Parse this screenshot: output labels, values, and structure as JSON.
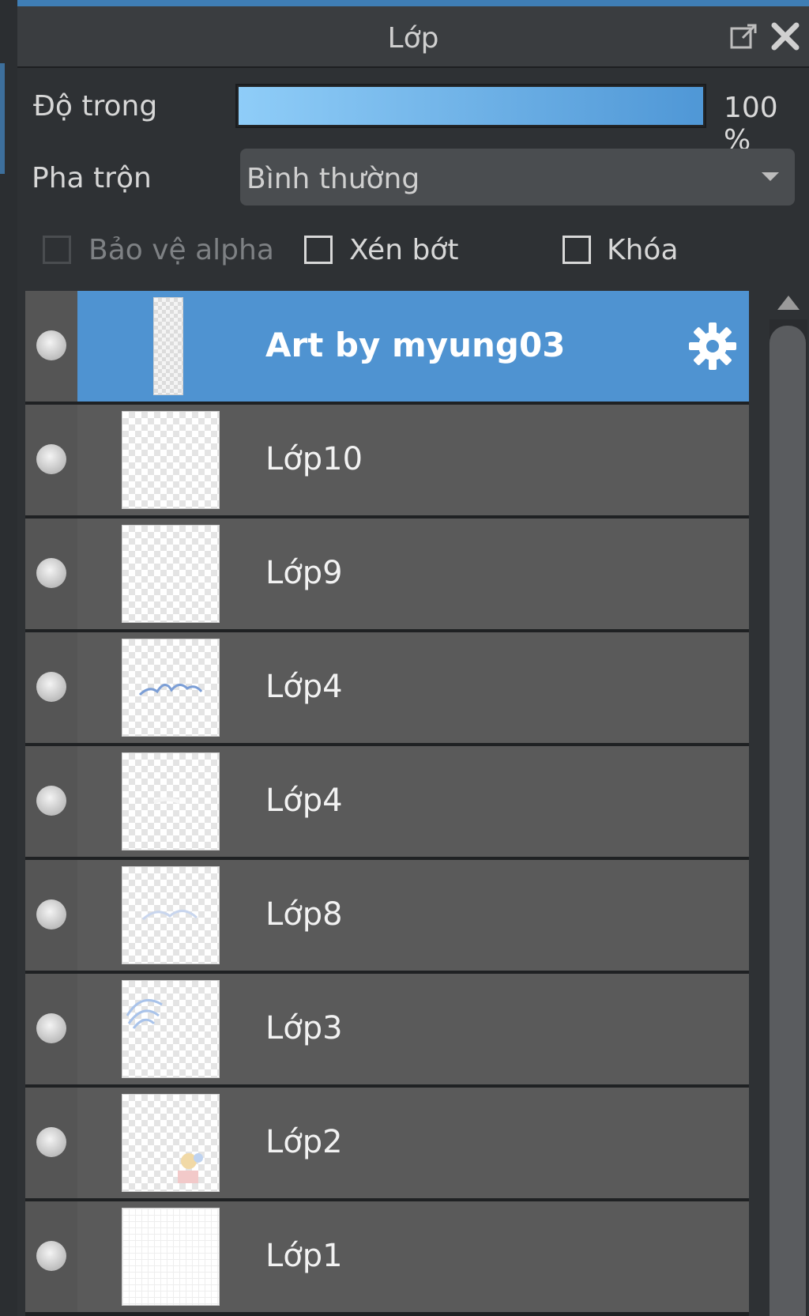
{
  "panel": {
    "title": "Lớp",
    "header_icons": [
      "popout-icon",
      "close-icon"
    ]
  },
  "opacity": {
    "label": "Độ trong",
    "value_text": "100 %",
    "value": 100
  },
  "blend": {
    "label": "Pha trộn",
    "selected": "Bình thường"
  },
  "options": {
    "protect_alpha": {
      "label": "Bảo vệ alpha",
      "checked": false,
      "disabled": true
    },
    "clipping": {
      "label": "Xén bớt",
      "checked": false
    },
    "lock": {
      "label": "Khóa",
      "checked": false
    }
  },
  "layers": [
    {
      "name": "Art by myung03",
      "selected": true,
      "visible": true,
      "folder": true
    },
    {
      "name": "Lớp10",
      "visible": true
    },
    {
      "name": "Lớp9",
      "visible": true
    },
    {
      "name": "Lớp4",
      "visible": true
    },
    {
      "name": "Lớp4",
      "visible": true
    },
    {
      "name": "Lớp8",
      "visible": true
    },
    {
      "name": "Lớp3",
      "visible": true
    },
    {
      "name": "Lớp2",
      "visible": true
    },
    {
      "name": "Lớp1",
      "visible": true
    }
  ],
  "colors": {
    "accent": "#4f93d1",
    "panel_bg": "#2e3134",
    "row_bg": "#5a5a5a"
  }
}
